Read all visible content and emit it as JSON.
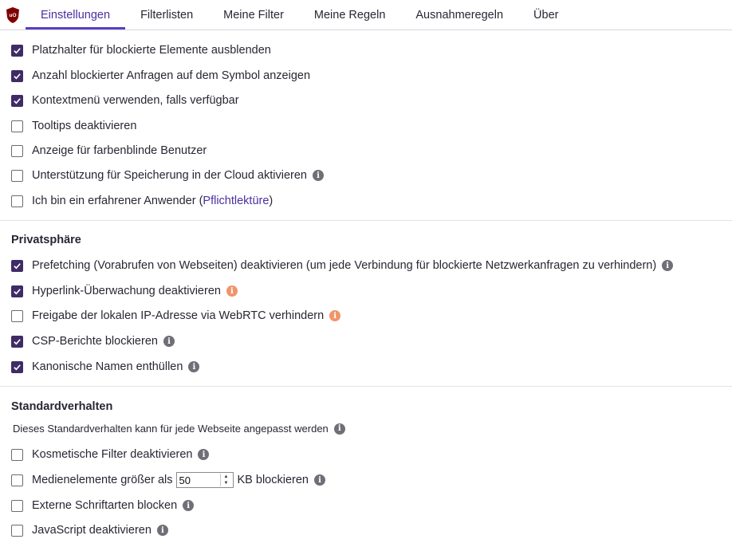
{
  "tabs": [
    {
      "label": "Einstellungen",
      "active": true
    },
    {
      "label": "Filterlisten",
      "active": false
    },
    {
      "label": "Meine Filter",
      "active": false
    },
    {
      "label": "Meine Regeln",
      "active": false
    },
    {
      "label": "Ausnahmeregeln",
      "active": false
    },
    {
      "label": "Über",
      "active": false
    }
  ],
  "appearance": {
    "items": [
      {
        "label": "Platzhalter für blockierte Elemente ausblenden",
        "checked": true
      },
      {
        "label": "Anzahl blockierter Anfragen auf dem Symbol anzeigen",
        "checked": true
      },
      {
        "label": "Kontextmenü verwenden, falls verfügbar",
        "checked": true
      },
      {
        "label": "Tooltips deaktivieren",
        "checked": false
      },
      {
        "label": "Anzeige für farbenblinde Benutzer",
        "checked": false
      },
      {
        "label": "Unterstützung für Speicherung in der Cloud aktivieren",
        "checked": false,
        "info": "gray"
      },
      {
        "label_prefix": "Ich bin ein erfahrener Anwender (",
        "link": "Pflichtlektüre",
        "label_suffix": ")",
        "checked": false
      }
    ]
  },
  "privacy": {
    "heading": "Privatsphäre",
    "items": [
      {
        "label": "Prefetching (Vorabrufen von Webseiten) deaktivieren (um jede Verbindung für blockierte Netzwerkanfragen zu verhindern)",
        "checked": true,
        "info": "gray"
      },
      {
        "label": "Hyperlink-Überwachung deaktivieren",
        "checked": true,
        "info": "orange"
      },
      {
        "label": "Freigabe der lokalen IP-Adresse via WebRTC verhindern",
        "checked": false,
        "info": "orange"
      },
      {
        "label": "CSP-Berichte blockieren",
        "checked": true,
        "info": "gray"
      },
      {
        "label": "Kanonische Namen enthüllen",
        "checked": true,
        "info": "gray"
      }
    ]
  },
  "defaults": {
    "heading": "Standardverhalten",
    "note": "Dieses Standardverhalten kann für jede Webseite angepasst werden",
    "items": [
      {
        "label": "Kosmetische Filter deaktivieren",
        "checked": false,
        "info": "gray"
      },
      {
        "label_prefix": "Medienelemente größer als",
        "value": "50",
        "label_suffix": "KB blockieren",
        "checked": false,
        "info": "gray"
      },
      {
        "label": "Externe Schriftarten blocken",
        "checked": false,
        "info": "gray"
      },
      {
        "label": "JavaScript deaktivieren",
        "checked": false,
        "info": "gray"
      }
    ]
  },
  "colors": {
    "accent": "#5a3fc4",
    "checkbox_checked": "#3f2c66",
    "info_orange": "#f0956a",
    "logo": "#800000"
  },
  "icons": {
    "logo": "ublock-origin-logo",
    "info": "info-icon",
    "check": "check-icon"
  }
}
